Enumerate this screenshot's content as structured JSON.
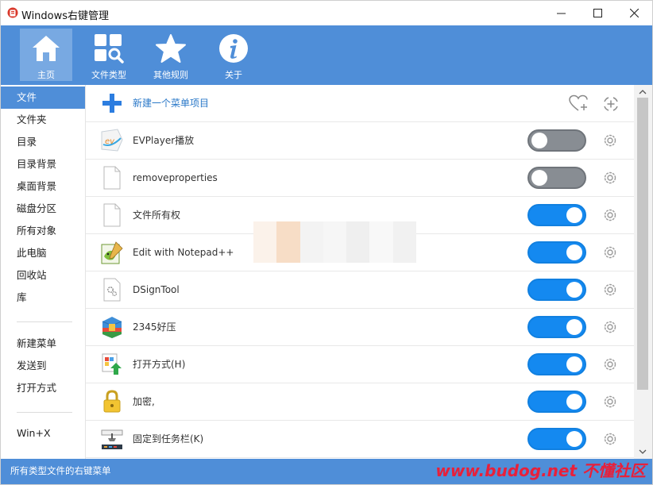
{
  "window": {
    "title": "Windows右键管理"
  },
  "toolbar": {
    "items": [
      {
        "label": "主页",
        "icon": "home-icon"
      },
      {
        "label": "文件类型",
        "icon": "file-types-icon"
      },
      {
        "label": "其他规则",
        "icon": "star-icon"
      },
      {
        "label": "关于",
        "icon": "info-icon"
      }
    ]
  },
  "sidebar": {
    "items": [
      {
        "label": "文件"
      },
      {
        "label": "文件夹"
      },
      {
        "label": "目录"
      },
      {
        "label": "目录背景"
      },
      {
        "label": "桌面背景"
      },
      {
        "label": "磁盘分区"
      },
      {
        "label": "所有对象"
      },
      {
        "label": "此电脑"
      },
      {
        "label": "回收站"
      },
      {
        "label": "库"
      },
      {
        "label": "新建菜单"
      },
      {
        "label": "发送到"
      },
      {
        "label": "打开方式"
      },
      {
        "label": "Win+X"
      }
    ],
    "active": "文件"
  },
  "main": {
    "new_item_label": "新建一个菜单项目",
    "rows": [
      {
        "label": "EVPlayer播放",
        "enabled": false,
        "icon": "evplayer-icon"
      },
      {
        "label": "removeproperties",
        "enabled": false,
        "icon": "blank-file-icon"
      },
      {
        "label": "文件所有权",
        "enabled": true,
        "icon": "blank-file-icon"
      },
      {
        "label": "Edit with Notepad++",
        "enabled": true,
        "icon": "notepad-plus-plus-icon"
      },
      {
        "label": "DSignTool",
        "enabled": true,
        "icon": "dsigntool-icon"
      },
      {
        "label": "2345好压",
        "enabled": true,
        "icon": "haozip-icon"
      },
      {
        "label": "打开方式(H)",
        "enabled": true,
        "icon": "open-with-icon"
      },
      {
        "label": "加密,",
        "enabled": true,
        "icon": "lock-icon"
      },
      {
        "label": "固定到任务栏(K)",
        "enabled": true,
        "icon": "pin-taskbar-icon"
      }
    ]
  },
  "statusbar": {
    "text": "所有类型文件的右键菜单",
    "watermark": "www.budog.net 不懂社区"
  },
  "colors": {
    "accent": "#4f8ed8",
    "toggle_on": "#1489f0",
    "toggle_off": "#888d93",
    "watermark": "#e8203a"
  }
}
